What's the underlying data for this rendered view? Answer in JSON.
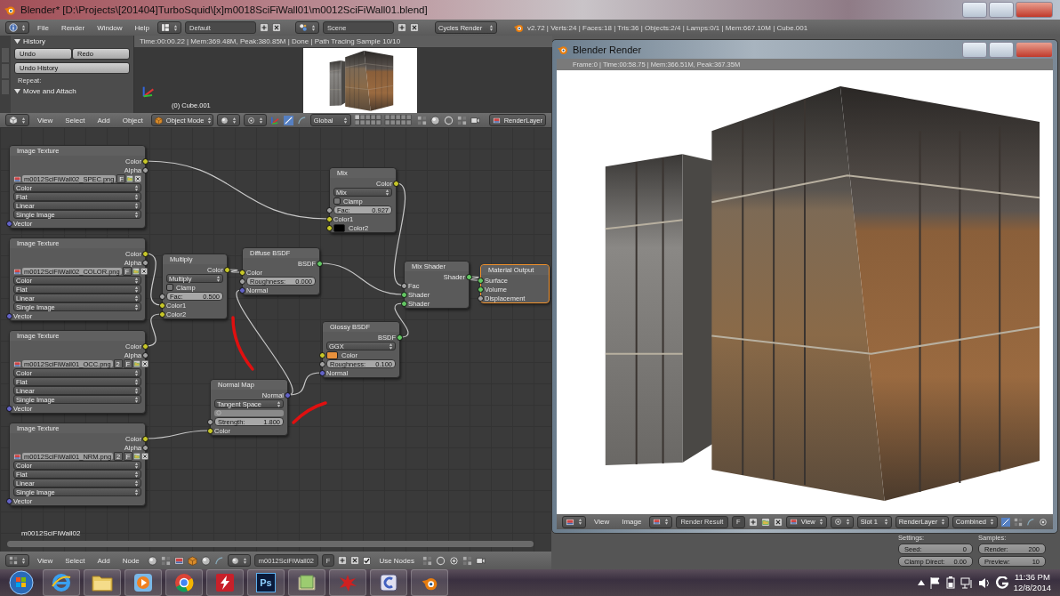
{
  "window": {
    "title": "Blender* [D:\\Projects\\[201404]TurboSquid\\[x]m0018SciFiWall01\\m0012SciFiWall01.blend]"
  },
  "info_header": {
    "menus": [
      "File",
      "Render",
      "Window",
      "Help"
    ],
    "layout": "Default",
    "scene": "Scene",
    "engine": "Cycles Render",
    "stats": "v2.72 | Verts:24 | Faces:18 | Tris:36 | Objects:2/4 | Lamps:0/1 | Mem:667.10M | Cube.001"
  },
  "tool_shelf": {
    "panels": [
      {
        "title": "History",
        "expanded": true,
        "buttons": [
          "Undo",
          "Redo",
          "Undo History"
        ],
        "label": "Repeat:"
      },
      {
        "title": "Move and Attach",
        "expanded": true
      }
    ]
  },
  "viewport": {
    "render_info": "Time:00:00.22 | Mem:369.48M, Peak:380.85M | Done | Path Tracing Sample 10/10",
    "object_label": "(0) Cube.001"
  },
  "viewport_header": {
    "menus": [
      "View",
      "Select",
      "Add",
      "Object"
    ],
    "mode": "Object Mode",
    "orientation": "Global",
    "render_layer": "RenderLayer"
  },
  "node_editor": {
    "material_label": "m0012SciFiWall02",
    "nodes": [
      {
        "title": "Image Texture",
        "selected": false,
        "rows": [
          {
            "kind": "output",
            "label": "Color",
            "socket": {
              "color": "#c7c729"
            }
          },
          {
            "kind": "output",
            "label": "Alpha",
            "socket": {
              "color": "#a1a1a1"
            }
          },
          {
            "kind": "image",
            "value": "m0012SciFiWall02_SPEC.png",
            "flag": "F"
          },
          {
            "kind": "dropdown",
            "value": "Color"
          },
          {
            "kind": "dropdown",
            "value": "Flat"
          },
          {
            "kind": "dropdown",
            "value": "Linear"
          },
          {
            "kind": "dropdown",
            "value": "Single Image"
          },
          {
            "kind": "input",
            "label": "Vector",
            "socket": {
              "color": "#6363c7"
            }
          }
        ]
      },
      {
        "title": "Image Texture",
        "selected": false,
        "rows": [
          {
            "kind": "output",
            "label": "Color",
            "socket": {
              "color": "#c7c729"
            }
          },
          {
            "kind": "output",
            "label": "Alpha",
            "socket": {
              "color": "#a1a1a1"
            }
          },
          {
            "kind": "image",
            "value": "m0012SciFiWall02_COLOR.png",
            "flag": "F"
          },
          {
            "kind": "dropdown",
            "value": "Color"
          },
          {
            "kind": "dropdown",
            "value": "Flat"
          },
          {
            "kind": "dropdown",
            "value": "Linear"
          },
          {
            "kind": "dropdown",
            "value": "Single Image"
          },
          {
            "kind": "input",
            "label": "Vector",
            "socket": {
              "color": "#6363c7"
            }
          }
        ]
      },
      {
        "title": "Image Texture",
        "selected": false,
        "rows": [
          {
            "kind": "output",
            "label": "Color",
            "socket": {
              "color": "#c7c729"
            }
          },
          {
            "kind": "output",
            "label": "Alpha",
            "socket": {
              "color": "#a1a1a1"
            }
          },
          {
            "kind": "image",
            "value": "m0012SciFiWall01_OCC.png",
            "users": "2",
            "flag": "F"
          },
          {
            "kind": "dropdown",
            "value": "Color"
          },
          {
            "kind": "dropdown",
            "value": "Flat"
          },
          {
            "kind": "dropdown",
            "value": "Linear"
          },
          {
            "kind": "dropdown",
            "value": "Single Image"
          },
          {
            "kind": "input",
            "label": "Vector",
            "socket": {
              "color": "#6363c7"
            }
          }
        ]
      },
      {
        "title": "Image Texture",
        "selected": false,
        "rows": [
          {
            "kind": "output",
            "label": "Color",
            "socket": {
              "color": "#c7c729"
            }
          },
          {
            "kind": "output",
            "label": "Alpha",
            "socket": {
              "color": "#a1a1a1"
            }
          },
          {
            "kind": "image",
            "value": "m0012SciFiWall01_NRM.png",
            "users": "2",
            "flag": "F"
          },
          {
            "kind": "dropdown",
            "value": "Color"
          },
          {
            "kind": "dropdown",
            "value": "Flat"
          },
          {
            "kind": "dropdown",
            "value": "Linear"
          },
          {
            "kind": "dropdown",
            "value": "Single Image"
          },
          {
            "kind": "input",
            "label": "Vector",
            "socket": {
              "color": "#6363c7"
            }
          }
        ]
      },
      {
        "title": "Multiply",
        "selected": false,
        "rows": [
          {
            "kind": "output",
            "label": "Color",
            "socket": {
              "color": "#c7c729"
            }
          },
          {
            "kind": "dropdown",
            "value": "Multiply"
          },
          {
            "kind": "checkbox",
            "label": "Clamp",
            "checked": false
          },
          {
            "kind": "slider",
            "label": "Fac:",
            "value": "0.500",
            "socket": {
              "color": "#a1a1a1"
            }
          },
          {
            "kind": "input",
            "label": "Color1",
            "socket": {
              "color": "#c7c729"
            }
          },
          {
            "kind": "input",
            "label": "Color2",
            "socket": {
              "color": "#c7c729"
            }
          }
        ]
      },
      {
        "title": "Diffuse BSDF",
        "selected": false,
        "rows": [
          {
            "kind": "output",
            "label": "BSDF",
            "socket": {
              "color": "#63c763"
            }
          },
          {
            "kind": "input",
            "label": "Color",
            "socket": {
              "color": "#c7c729"
            }
          },
          {
            "kind": "slider",
            "label": "Roughness:",
            "value": "0.000",
            "socket": {
              "color": "#a1a1a1"
            }
          },
          {
            "kind": "input",
            "label": "Normal",
            "socket": {
              "color": "#6363c7"
            }
          }
        ]
      },
      {
        "title": "Mix",
        "selected": false,
        "rows": [
          {
            "kind": "output",
            "label": "Color",
            "socket": {
              "color": "#c7c729"
            }
          },
          {
            "kind": "dropdown",
            "value": "Mix"
          },
          {
            "kind": "checkbox",
            "label": "Clamp",
            "checked": false
          },
          {
            "kind": "slider",
            "label": "Fac:",
            "value": "0.927",
            "socket": {
              "color": "#a1a1a1"
            }
          },
          {
            "kind": "input",
            "label": "Color1",
            "socket": {
              "color": "#c7c729"
            }
          },
          {
            "kind": "color",
            "label": "Color2",
            "color": "#000000",
            "socket": {
              "color": "#c7c729"
            }
          }
        ]
      },
      {
        "title": "Mix Shader",
        "selected": false,
        "rows": [
          {
            "kind": "output",
            "label": "Shader",
            "socket": {
              "color": "#63c763"
            }
          },
          {
            "kind": "input",
            "label": "Fac",
            "socket": {
              "color": "#a1a1a1"
            }
          },
          {
            "kind": "input",
            "label": "Shader",
            "socket": {
              "color": "#63c763"
            }
          },
          {
            "kind": "input",
            "label": "Shader",
            "socket": {
              "color": "#63c763"
            }
          }
        ]
      },
      {
        "title": "Material Output",
        "selected": true,
        "rows": [
          {
            "kind": "input",
            "label": "Surface",
            "socket": {
              "color": "#63c763"
            }
          },
          {
            "kind": "input",
            "label": "Volume",
            "socket": {
              "color": "#63c763"
            }
          },
          {
            "kind": "input",
            "label": "Displacement",
            "socket": {
              "color": "#a1a1a1"
            }
          }
        ]
      },
      {
        "title": "Glossy BSDF",
        "selected": false,
        "rows": [
          {
            "kind": "output",
            "label": "BSDF",
            "socket": {
              "color": "#63c763"
            }
          },
          {
            "kind": "dropdown",
            "value": "GGX"
          },
          {
            "kind": "color",
            "label": "Color",
            "color": "#e8913c",
            "socket": {
              "color": "#c7c729"
            }
          },
          {
            "kind": "slider",
            "label": "Roughness:",
            "value": "0.100",
            "socket": {
              "color": "#a1a1a1"
            }
          },
          {
            "kind": "input",
            "label": "Normal",
            "socket": {
              "color": "#6363c7"
            }
          }
        ]
      },
      {
        "title": "Normal Map",
        "selected": false,
        "rows": [
          {
            "kind": "output",
            "label": "Normal",
            "socket": {
              "color": "#6363c7"
            }
          },
          {
            "kind": "dropdown",
            "value": "Tangent Space"
          },
          {
            "kind": "uvfield"
          },
          {
            "kind": "slider",
            "label": "Strength:",
            "value": "1.800",
            "socket": {
              "color": "#a1a1a1"
            }
          },
          {
            "kind": "input",
            "label": "Color",
            "socket": {
              "color": "#c7c729"
            }
          }
        ]
      }
    ]
  },
  "node_header": {
    "menus": [
      "View",
      "Select",
      "Add",
      "Node"
    ],
    "material": "m0012SciFiWall02",
    "flag": "F",
    "use_nodes": {
      "label": "Use Nodes",
      "checked": true
    }
  },
  "render_settings": {
    "columns": [
      {
        "title": "Settings:",
        "fields": [
          {
            "label": "Seed:",
            "value": "0"
          },
          {
            "label": "Clamp Direct:",
            "value": "0.00"
          }
        ]
      },
      {
        "title": "Samples:",
        "fields": [
          {
            "label": "Render:",
            "value": "200"
          },
          {
            "label": "Preview:",
            "value": "10"
          }
        ]
      }
    ]
  },
  "render_window": {
    "title": "Blender Render",
    "status": "Frame:0 | Time:00:58.75 | Mem:366.51M, Peak:367.35M",
    "menus": [
      "View",
      "Image"
    ],
    "image": "Render Result",
    "flag": "F",
    "view": "View",
    "slot": "Slot 1",
    "layer": "RenderLayer",
    "pass": "Combined"
  },
  "taskbar": {
    "apps": [
      {
        "kind": "start"
      },
      {
        "kind": "browser"
      },
      {
        "kind": "folder"
      },
      {
        "kind": "media"
      },
      {
        "kind": "chrome"
      },
      {
        "kind": "flash"
      },
      {
        "kind": "photoshop",
        "label": "Ps"
      },
      {
        "kind": "notes"
      },
      {
        "kind": "splat"
      },
      {
        "kind": "tool"
      },
      {
        "kind": "blender"
      }
    ],
    "time": "11:36 PM",
    "date": "12/8/2014"
  }
}
